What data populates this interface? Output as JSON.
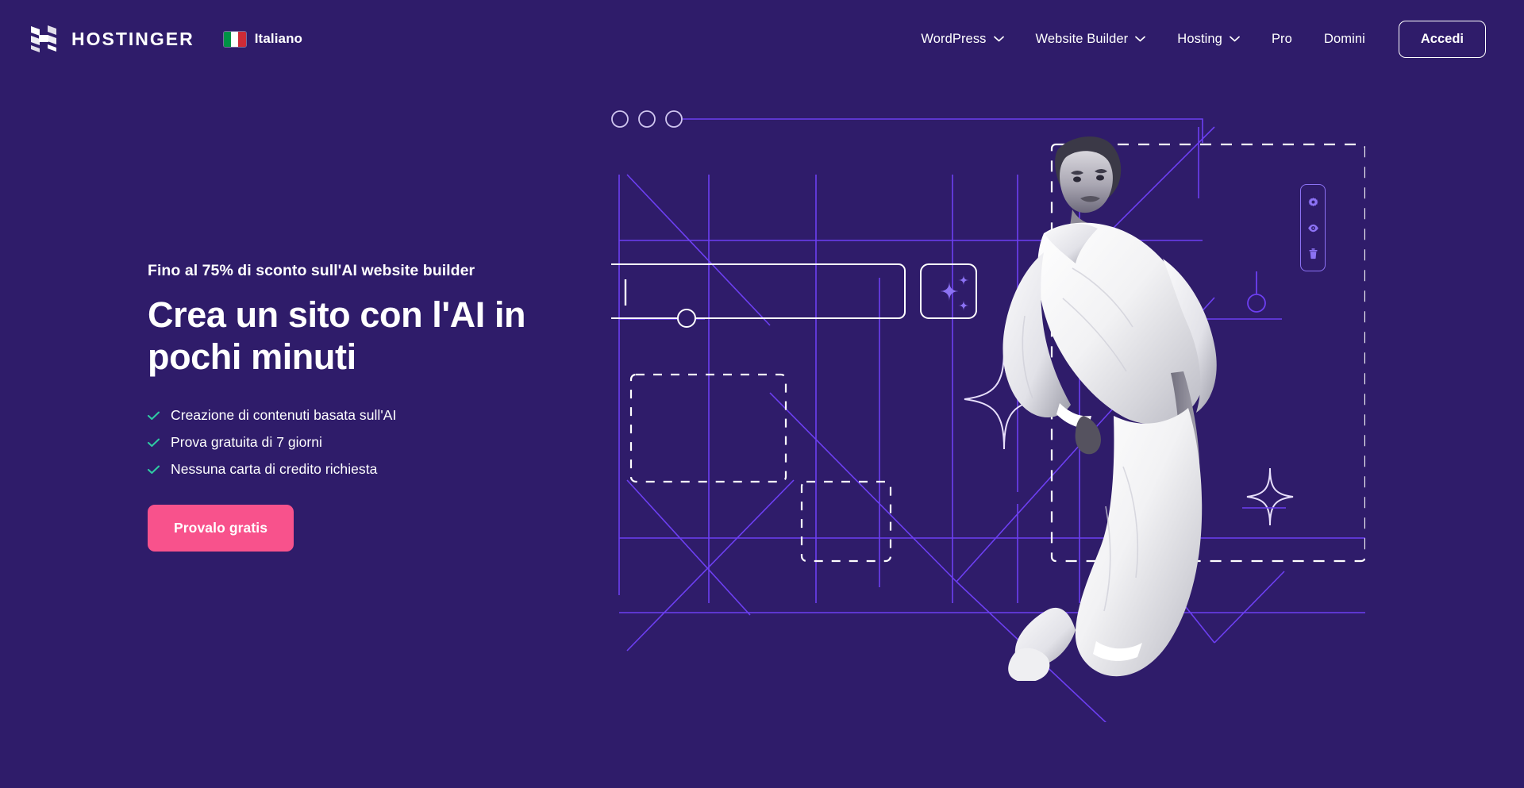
{
  "brand": {
    "logo_icon": "hostinger-h-icon",
    "name": "HOSTINGER"
  },
  "language_selector": {
    "icon": "italy-flag-icon",
    "label": "Italiano",
    "flag_colors": [
      "#009246",
      "#ffffff",
      "#ce2b37"
    ]
  },
  "nav": {
    "items": [
      {
        "label": "WordPress",
        "has_dropdown": true,
        "icon": "chevron-down-icon"
      },
      {
        "label": "Website Builder",
        "has_dropdown": true,
        "icon": "chevron-down-icon"
      },
      {
        "label": "Hosting",
        "has_dropdown": true,
        "icon": "chevron-down-icon"
      },
      {
        "label": "Pro",
        "has_dropdown": false
      },
      {
        "label": "Domini",
        "has_dropdown": false
      }
    ],
    "login_label": "Accedi"
  },
  "hero": {
    "eyebrow": "Fino al 75% di sconto sull'AI website builder",
    "headline": "Crea un sito con l'AI in pochi minuti",
    "features": [
      {
        "icon": "check-icon",
        "label": "Creazione di contenuti basata sull'AI"
      },
      {
        "icon": "check-icon",
        "label": "Prova gratuita di 7 giorni"
      },
      {
        "icon": "check-icon",
        "label": "Nessuna carta di credito richiesta"
      }
    ],
    "cta_label": "Provalo gratis"
  },
  "illustration": {
    "browser_dots": 3,
    "prompt_input": {
      "value": "",
      "icon": "text-cursor-icon"
    },
    "ai_button_icon": "sparkles-icon",
    "placeholder_boxes": 2,
    "decor_stars": 2,
    "image_subject": "fashion-model-photo",
    "editor_toolbar": [
      {
        "icon": "gear-icon",
        "label": "Impostazioni"
      },
      {
        "icon": "eye-icon",
        "label": "Anteprima"
      },
      {
        "icon": "trash-icon",
        "label": "Elimina"
      }
    ]
  },
  "colors": {
    "background": "#2f1c6a",
    "accent_pink": "#f8528c",
    "accent_purple": "#673de6",
    "line_purple": "#6d3ff2",
    "check_green": "#2fc9a2",
    "white": "#ffffff"
  }
}
